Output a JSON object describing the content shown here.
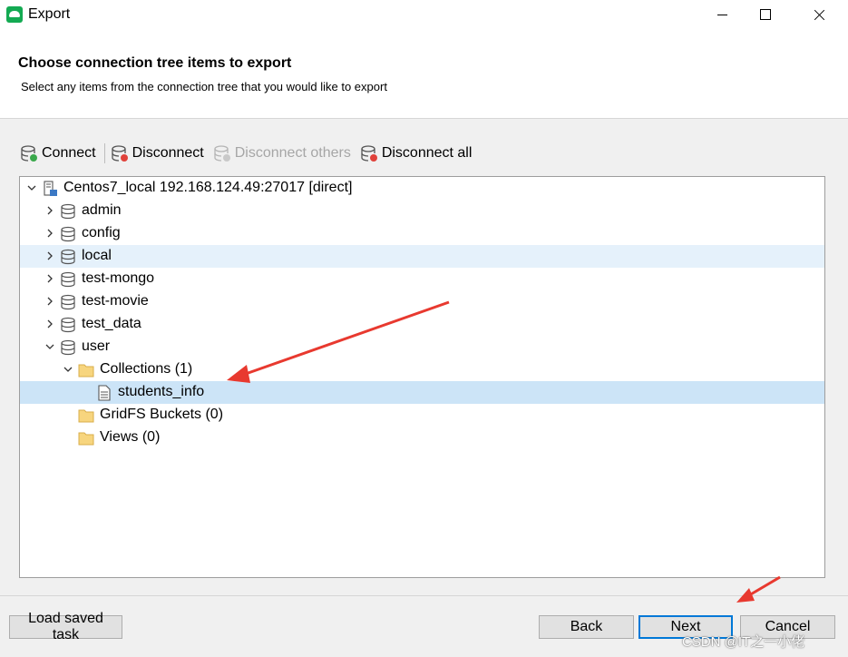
{
  "window": {
    "title": "Export",
    "controls": [
      "minimize",
      "maximize",
      "close"
    ]
  },
  "header": {
    "title": "Choose connection tree items to export",
    "subtitle": "Select any items from the connection tree that you would like to export"
  },
  "toolbar": {
    "connect": {
      "label": "Connect",
      "icon": "database-connect-icon",
      "enabled": true
    },
    "disconnect": {
      "label": "Disconnect",
      "icon": "database-disconnect-icon",
      "enabled": true
    },
    "disconnect_others": {
      "label": "Disconnect others",
      "icon": "database-disconnect-others-icon",
      "enabled": false
    },
    "disconnect_all": {
      "label": "Disconnect all",
      "icon": "database-disconnect-all-icon",
      "enabled": true
    }
  },
  "tree": {
    "connection": {
      "label": "Centos7_local 192.168.124.49:27017 [direct]",
      "icon": "server-icon",
      "expanded": true
    },
    "databases": [
      {
        "label": "admin",
        "expanded": false
      },
      {
        "label": "config",
        "expanded": false
      },
      {
        "label": "local",
        "expanded": false,
        "hovered": true
      },
      {
        "label": "test-mongo",
        "expanded": false
      },
      {
        "label": "test-movie",
        "expanded": false
      },
      {
        "label": "test_data",
        "expanded": false
      },
      {
        "label": "user",
        "expanded": true
      }
    ],
    "user_children": [
      {
        "label": "Collections (1)",
        "icon": "folder-icon",
        "expanded": true
      },
      {
        "label": "students_info",
        "icon": "collection-icon",
        "selected": true
      },
      {
        "label": "GridFS Buckets (0)",
        "icon": "folder-icon"
      },
      {
        "label": "Views (0)",
        "icon": "folder-icon"
      }
    ]
  },
  "footer": {
    "load_saved_task": "Load saved task",
    "back": "Back",
    "next": "Next",
    "cancel": "Cancel"
  },
  "watermark": "CSDN @IT之一小佬",
  "colors": {
    "accent": "#0078d7",
    "selection": "#cce4f7",
    "hover": "#e5f1fb",
    "brand": "#13aa52",
    "annotation_arrow": "#e8392f"
  }
}
